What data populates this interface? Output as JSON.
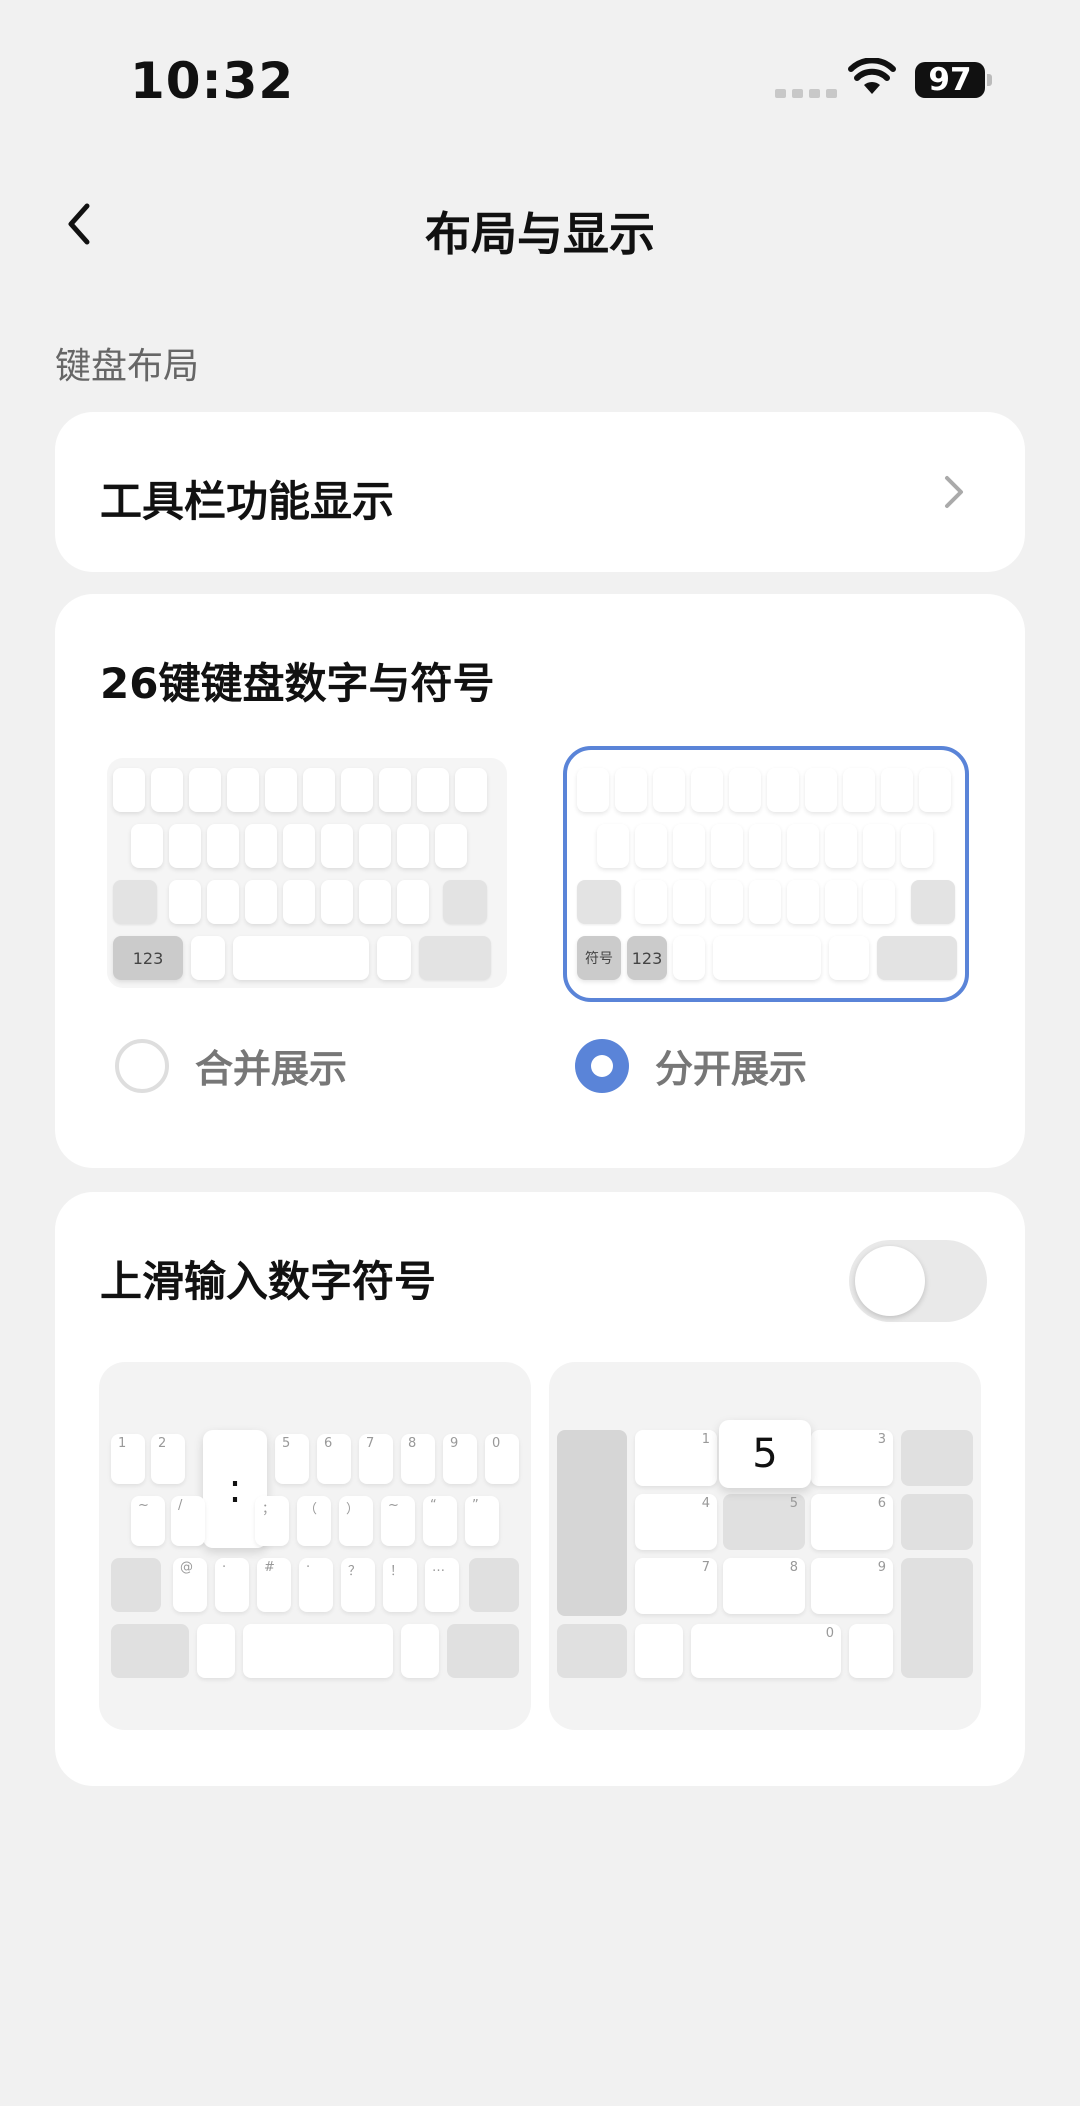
{
  "status": {
    "time": "10:32",
    "battery": "97",
    "icons": [
      "signal-icon",
      "wifi-icon",
      "battery-icon"
    ]
  },
  "nav": {
    "title": "布局与显示",
    "back_icon": "chevron-left-icon"
  },
  "section": {
    "keyboard_layout": "键盘布局"
  },
  "toolbar_card": {
    "label": "工具栏功能显示",
    "chevron_icon": "chevron-right-icon"
  },
  "numbers_card": {
    "title": "26键键盘数字与符号",
    "options": [
      {
        "label": "合并展示",
        "selected": false,
        "key_123": "123"
      },
      {
        "label": "分开展示",
        "selected": true,
        "key_symbol": "符号",
        "key_123": "123"
      }
    ]
  },
  "swipe_card": {
    "title": "上滑输入数字符号",
    "toggle_on": false,
    "preview1": {
      "top_row": [
        "1",
        "2",
        "",
        "",
        "5",
        "6",
        "7",
        "8",
        "9",
        "0"
      ],
      "second_row": [
        "~",
        "/",
        "",
        "；",
        "（",
        "）",
        "~",
        "“",
        "”"
      ],
      "third_row": [
        "@",
        "·",
        "#",
        "·",
        "？",
        "！",
        "…"
      ],
      "popup": ":"
    },
    "preview2": {
      "digits": [
        "1",
        "3",
        "4",
        "5",
        "6",
        "7",
        "8",
        "9",
        "0"
      ],
      "popup": "5"
    }
  },
  "colors": {
    "accent": "#5a84d8",
    "background": "#f1f1f1",
    "card": "#ffffff"
  }
}
